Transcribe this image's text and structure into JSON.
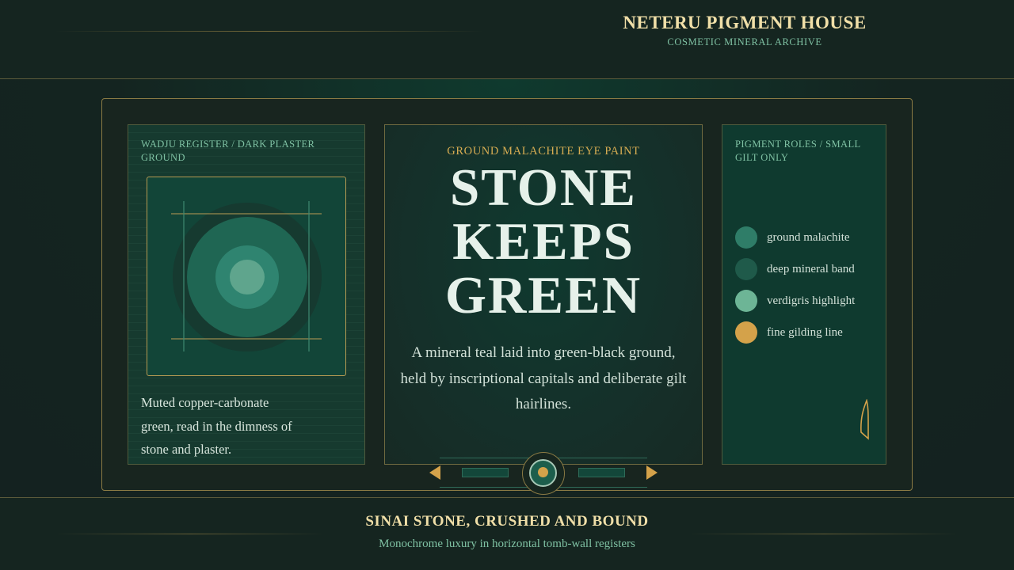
{
  "header": {
    "brand_title": "NETERU PIGMENT HOUSE",
    "brand_subtitle": "COSMETIC MINERAL ARCHIVE"
  },
  "left_panel": {
    "label": "WADJU REGISTER / DARK PLASTER GROUND",
    "caption": "Muted copper-carbonate green, read in the dimness of stone and plaster.",
    "emblem_icon": "concentric-disc-emblem-icon"
  },
  "center_panel": {
    "eyebrow": "GROUND MALACHITE EYE PAINT",
    "hero_lines": [
      "STONE",
      "KEEPS",
      "GREEN"
    ],
    "body": "A mineral teal laid into green-black ground, held by inscriptional capitals and deliberate gilt hairlines."
  },
  "right_panel": {
    "label": "PIGMENT ROLES / SMALL GILT ONLY",
    "swatches": [
      {
        "label": "ground malachite",
        "color": "#2f7d68"
      },
      {
        "label": "deep mineral band",
        "color": "#1f5a4a"
      },
      {
        "label": "verdigris highlight",
        "color": "#6db596"
      },
      {
        "label": "fine gilding line",
        "color": "#d4a24a"
      }
    ],
    "feather_icon": "reed-feather-icon"
  },
  "pager": {
    "prev_icon": "triangle-left-icon",
    "next_icon": "triangle-right-icon",
    "knob_icon": "gilt-disc-icon"
  },
  "footer": {
    "title": "SINAI STONE, CRUSHED AND BOUND",
    "subtitle": "Monochrome luxury in horizontal tomb-wall registers"
  },
  "colors": {
    "background": "#15241f",
    "gold": "#d4a24a",
    "malachite": "#2f7d68",
    "label_teal": "#7fc1a3",
    "title_cream": "#f0dfa8"
  }
}
